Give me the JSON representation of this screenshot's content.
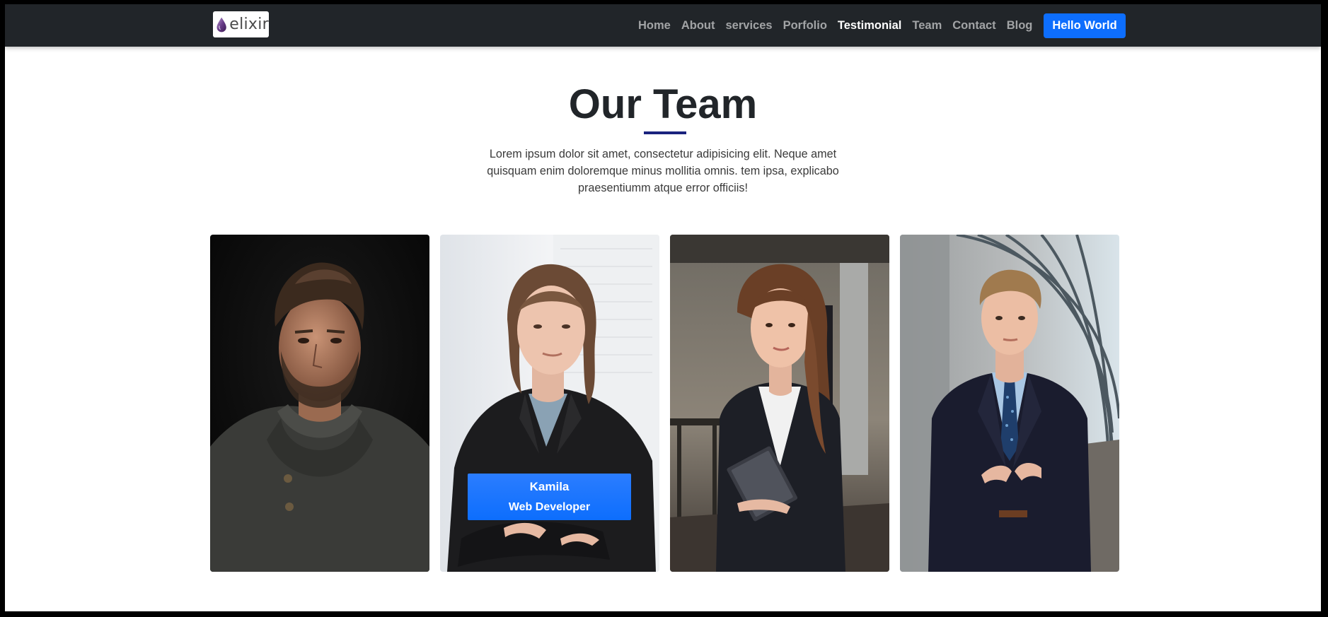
{
  "brand": {
    "name": "elixir",
    "logo_icon": "drop-icon",
    "accent": "#6a3d8a"
  },
  "nav": {
    "links": [
      {
        "label": "Home"
      },
      {
        "label": "About"
      },
      {
        "label": "services"
      },
      {
        "label": "Porfolio"
      },
      {
        "label": "Testimonial",
        "active": true
      },
      {
        "label": "Team"
      },
      {
        "label": "Contact"
      },
      {
        "label": "Blog"
      }
    ],
    "button_label": "Hello World"
  },
  "section": {
    "title": "Our Team",
    "lead": "Lorem ipsum dolor sit amet, consectetur adipisicing elit. Neque amet quisquam enim doloremque minus mollitia omnis. tem ipsa, explicabo praesentiumm atque error officiis!"
  },
  "team": [
    {
      "photo": "man-sweater-portrait"
    },
    {
      "photo": "woman-blazer-portrait",
      "name": "Kamila",
      "role": "Web Developer"
    },
    {
      "photo": "woman-notebook-portrait"
    },
    {
      "photo": "man-suit-portrait"
    }
  ],
  "colors": {
    "navbar": "#212529",
    "primary": "#0d6efd",
    "underline": "#1a237e"
  }
}
